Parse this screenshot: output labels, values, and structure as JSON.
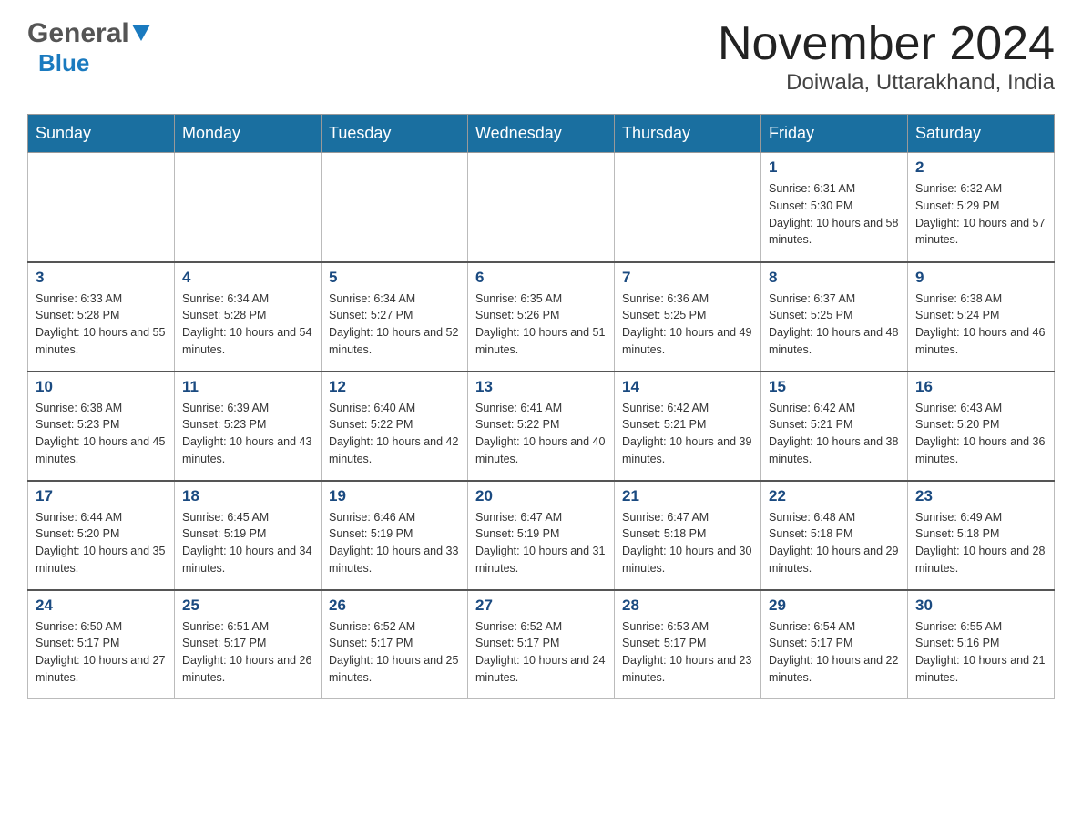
{
  "header": {
    "logo_general": "General",
    "logo_blue": "Blue",
    "month_title": "November 2024",
    "location": "Doiwala, Uttarakhand, India"
  },
  "days_of_week": [
    "Sunday",
    "Monday",
    "Tuesday",
    "Wednesday",
    "Thursday",
    "Friday",
    "Saturday"
  ],
  "weeks": [
    [
      {
        "day": "",
        "sunrise": "",
        "sunset": "",
        "daylight": ""
      },
      {
        "day": "",
        "sunrise": "",
        "sunset": "",
        "daylight": ""
      },
      {
        "day": "",
        "sunrise": "",
        "sunset": "",
        "daylight": ""
      },
      {
        "day": "",
        "sunrise": "",
        "sunset": "",
        "daylight": ""
      },
      {
        "day": "",
        "sunrise": "",
        "sunset": "",
        "daylight": ""
      },
      {
        "day": "1",
        "sunrise": "Sunrise: 6:31 AM",
        "sunset": "Sunset: 5:30 PM",
        "daylight": "Daylight: 10 hours and 58 minutes."
      },
      {
        "day": "2",
        "sunrise": "Sunrise: 6:32 AM",
        "sunset": "Sunset: 5:29 PM",
        "daylight": "Daylight: 10 hours and 57 minutes."
      }
    ],
    [
      {
        "day": "3",
        "sunrise": "Sunrise: 6:33 AM",
        "sunset": "Sunset: 5:28 PM",
        "daylight": "Daylight: 10 hours and 55 minutes."
      },
      {
        "day": "4",
        "sunrise": "Sunrise: 6:34 AM",
        "sunset": "Sunset: 5:28 PM",
        "daylight": "Daylight: 10 hours and 54 minutes."
      },
      {
        "day": "5",
        "sunrise": "Sunrise: 6:34 AM",
        "sunset": "Sunset: 5:27 PM",
        "daylight": "Daylight: 10 hours and 52 minutes."
      },
      {
        "day": "6",
        "sunrise": "Sunrise: 6:35 AM",
        "sunset": "Sunset: 5:26 PM",
        "daylight": "Daylight: 10 hours and 51 minutes."
      },
      {
        "day": "7",
        "sunrise": "Sunrise: 6:36 AM",
        "sunset": "Sunset: 5:25 PM",
        "daylight": "Daylight: 10 hours and 49 minutes."
      },
      {
        "day": "8",
        "sunrise": "Sunrise: 6:37 AM",
        "sunset": "Sunset: 5:25 PM",
        "daylight": "Daylight: 10 hours and 48 minutes."
      },
      {
        "day": "9",
        "sunrise": "Sunrise: 6:38 AM",
        "sunset": "Sunset: 5:24 PM",
        "daylight": "Daylight: 10 hours and 46 minutes."
      }
    ],
    [
      {
        "day": "10",
        "sunrise": "Sunrise: 6:38 AM",
        "sunset": "Sunset: 5:23 PM",
        "daylight": "Daylight: 10 hours and 45 minutes."
      },
      {
        "day": "11",
        "sunrise": "Sunrise: 6:39 AM",
        "sunset": "Sunset: 5:23 PM",
        "daylight": "Daylight: 10 hours and 43 minutes."
      },
      {
        "day": "12",
        "sunrise": "Sunrise: 6:40 AM",
        "sunset": "Sunset: 5:22 PM",
        "daylight": "Daylight: 10 hours and 42 minutes."
      },
      {
        "day": "13",
        "sunrise": "Sunrise: 6:41 AM",
        "sunset": "Sunset: 5:22 PM",
        "daylight": "Daylight: 10 hours and 40 minutes."
      },
      {
        "day": "14",
        "sunrise": "Sunrise: 6:42 AM",
        "sunset": "Sunset: 5:21 PM",
        "daylight": "Daylight: 10 hours and 39 minutes."
      },
      {
        "day": "15",
        "sunrise": "Sunrise: 6:42 AM",
        "sunset": "Sunset: 5:21 PM",
        "daylight": "Daylight: 10 hours and 38 minutes."
      },
      {
        "day": "16",
        "sunrise": "Sunrise: 6:43 AM",
        "sunset": "Sunset: 5:20 PM",
        "daylight": "Daylight: 10 hours and 36 minutes."
      }
    ],
    [
      {
        "day": "17",
        "sunrise": "Sunrise: 6:44 AM",
        "sunset": "Sunset: 5:20 PM",
        "daylight": "Daylight: 10 hours and 35 minutes."
      },
      {
        "day": "18",
        "sunrise": "Sunrise: 6:45 AM",
        "sunset": "Sunset: 5:19 PM",
        "daylight": "Daylight: 10 hours and 34 minutes."
      },
      {
        "day": "19",
        "sunrise": "Sunrise: 6:46 AM",
        "sunset": "Sunset: 5:19 PM",
        "daylight": "Daylight: 10 hours and 33 minutes."
      },
      {
        "day": "20",
        "sunrise": "Sunrise: 6:47 AM",
        "sunset": "Sunset: 5:19 PM",
        "daylight": "Daylight: 10 hours and 31 minutes."
      },
      {
        "day": "21",
        "sunrise": "Sunrise: 6:47 AM",
        "sunset": "Sunset: 5:18 PM",
        "daylight": "Daylight: 10 hours and 30 minutes."
      },
      {
        "day": "22",
        "sunrise": "Sunrise: 6:48 AM",
        "sunset": "Sunset: 5:18 PM",
        "daylight": "Daylight: 10 hours and 29 minutes."
      },
      {
        "day": "23",
        "sunrise": "Sunrise: 6:49 AM",
        "sunset": "Sunset: 5:18 PM",
        "daylight": "Daylight: 10 hours and 28 minutes."
      }
    ],
    [
      {
        "day": "24",
        "sunrise": "Sunrise: 6:50 AM",
        "sunset": "Sunset: 5:17 PM",
        "daylight": "Daylight: 10 hours and 27 minutes."
      },
      {
        "day": "25",
        "sunrise": "Sunrise: 6:51 AM",
        "sunset": "Sunset: 5:17 PM",
        "daylight": "Daylight: 10 hours and 26 minutes."
      },
      {
        "day": "26",
        "sunrise": "Sunrise: 6:52 AM",
        "sunset": "Sunset: 5:17 PM",
        "daylight": "Daylight: 10 hours and 25 minutes."
      },
      {
        "day": "27",
        "sunrise": "Sunrise: 6:52 AM",
        "sunset": "Sunset: 5:17 PM",
        "daylight": "Daylight: 10 hours and 24 minutes."
      },
      {
        "day": "28",
        "sunrise": "Sunrise: 6:53 AM",
        "sunset": "Sunset: 5:17 PM",
        "daylight": "Daylight: 10 hours and 23 minutes."
      },
      {
        "day": "29",
        "sunrise": "Sunrise: 6:54 AM",
        "sunset": "Sunset: 5:17 PM",
        "daylight": "Daylight: 10 hours and 22 minutes."
      },
      {
        "day": "30",
        "sunrise": "Sunrise: 6:55 AM",
        "sunset": "Sunset: 5:16 PM",
        "daylight": "Daylight: 10 hours and 21 minutes."
      }
    ]
  ]
}
